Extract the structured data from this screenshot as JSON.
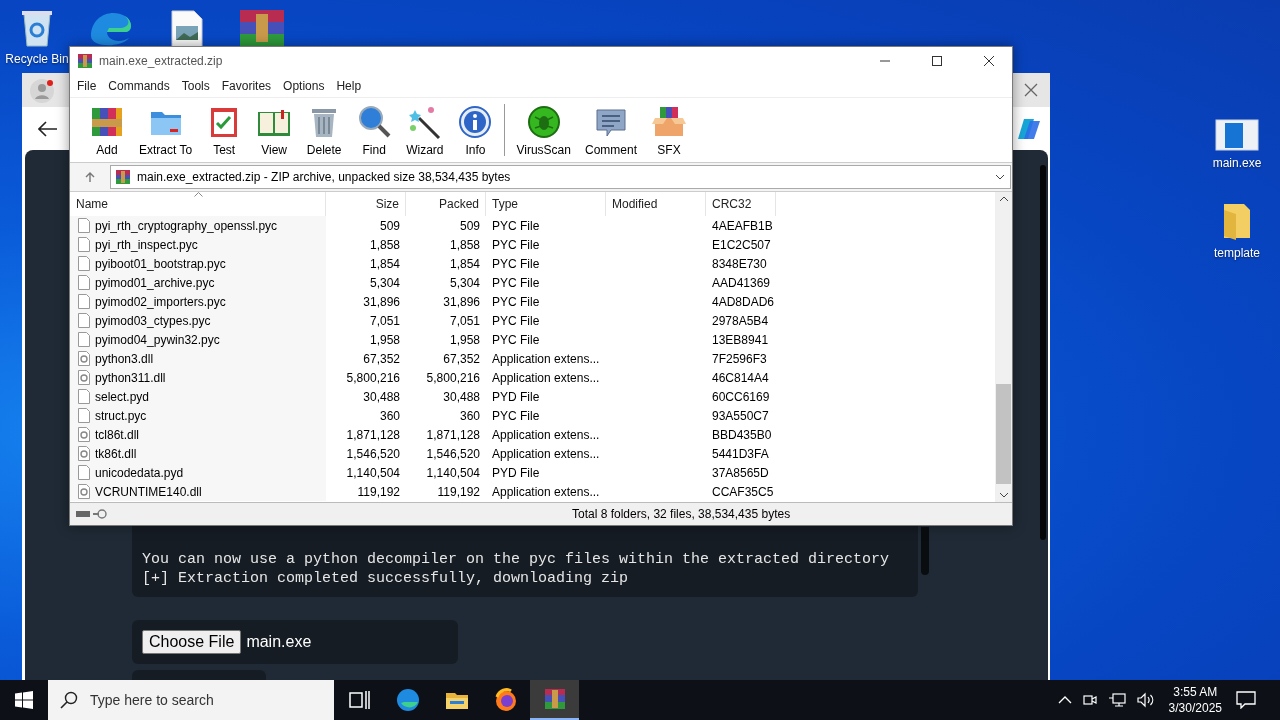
{
  "desktop": {
    "icons": [
      {
        "label": "Recycle Bin",
        "kind": "recycle"
      },
      {
        "label": "main.exe",
        "kind": "app"
      },
      {
        "label": "template",
        "kind": "folder"
      }
    ]
  },
  "browser": {
    "terminal_lines": [
      "You can now use a python decompiler on the pyc files within the extracted directory",
      "[+] Extraction completed successfully, downloading zip"
    ],
    "file_input": {
      "button": "Choose File",
      "value": "main.exe"
    }
  },
  "winrar": {
    "title": "main.exe_extracted.zip",
    "menu": [
      "File",
      "Commands",
      "Tools",
      "Favorites",
      "Options",
      "Help"
    ],
    "toolbar": [
      {
        "label": "Add",
        "kind": "add"
      },
      {
        "label": "Extract To",
        "kind": "extract"
      },
      {
        "label": "Test",
        "kind": "test"
      },
      {
        "label": "View",
        "kind": "view"
      },
      {
        "label": "Delete",
        "kind": "delete"
      },
      {
        "label": "Find",
        "kind": "find"
      },
      {
        "label": "Wizard",
        "kind": "wizard"
      },
      {
        "label": "Info",
        "kind": "info"
      },
      {
        "label": "VirusScan",
        "kind": "virusscan"
      },
      {
        "label": "Comment",
        "kind": "comment"
      },
      {
        "label": "SFX",
        "kind": "sfx"
      }
    ],
    "address": "main.exe_extracted.zip - ZIP archive, unpacked size 38,534,435 bytes",
    "columns": [
      {
        "label": "Name",
        "sorted": true
      },
      {
        "label": "Size",
        "sorted": false
      },
      {
        "label": "Packed",
        "sorted": false
      },
      {
        "label": "Type",
        "sorted": false
      },
      {
        "label": "Modified",
        "sorted": false
      },
      {
        "label": "CRC32",
        "sorted": false
      }
    ],
    "rows": [
      {
        "kind": "file",
        "name": "pyi_rth_cryptography_openssl.pyc",
        "size": "509",
        "packed": "509",
        "type": "PYC File",
        "crc32": "4AEAFB1B"
      },
      {
        "kind": "file",
        "name": "pyi_rth_inspect.pyc",
        "size": "1,858",
        "packed": "1,858",
        "type": "PYC File",
        "crc32": "E1C2C507"
      },
      {
        "kind": "file",
        "name": "pyiboot01_bootstrap.pyc",
        "size": "1,854",
        "packed": "1,854",
        "type": "PYC File",
        "crc32": "8348E730"
      },
      {
        "kind": "file",
        "name": "pyimod01_archive.pyc",
        "size": "5,304",
        "packed": "5,304",
        "type": "PYC File",
        "crc32": "AAD41369"
      },
      {
        "kind": "file",
        "name": "pyimod02_importers.pyc",
        "size": "31,896",
        "packed": "31,896",
        "type": "PYC File",
        "crc32": "4AD8DAD6"
      },
      {
        "kind": "file",
        "name": "pyimod03_ctypes.pyc",
        "size": "7,051",
        "packed": "7,051",
        "type": "PYC File",
        "crc32": "2978A5B4"
      },
      {
        "kind": "file",
        "name": "pyimod04_pywin32.pyc",
        "size": "1,958",
        "packed": "1,958",
        "type": "PYC File",
        "crc32": "13EB8941"
      },
      {
        "kind": "library",
        "name": "python3.dll",
        "size": "67,352",
        "packed": "67,352",
        "type": "Application extens...",
        "crc32": "7F2596F3"
      },
      {
        "kind": "library",
        "name": "python311.dll",
        "size": "5,800,216",
        "packed": "5,800,216",
        "type": "Application extens...",
        "crc32": "46C814A4"
      },
      {
        "kind": "file",
        "name": "select.pyd",
        "size": "30,488",
        "packed": "30,488",
        "type": "PYD File",
        "crc32": "60CC6169"
      },
      {
        "kind": "file",
        "name": "struct.pyc",
        "size": "360",
        "packed": "360",
        "type": "PYC File",
        "crc32": "93A550C7"
      },
      {
        "kind": "library",
        "name": "tcl86t.dll",
        "size": "1,871,128",
        "packed": "1,871,128",
        "type": "Application extens...",
        "crc32": "BBD435B0"
      },
      {
        "kind": "library",
        "name": "tk86t.dll",
        "size": "1,546,520",
        "packed": "1,546,520",
        "type": "Application extens...",
        "crc32": "5441D3FA"
      },
      {
        "kind": "file",
        "name": "unicodedata.pyd",
        "size": "1,140,504",
        "packed": "1,140,504",
        "type": "PYD File",
        "crc32": "37A8565D"
      },
      {
        "kind": "library",
        "name": "VCRUNTIME140.dll",
        "size": "119,192",
        "packed": "119,192",
        "type": "Application extens...",
        "crc32": "CCAF35C5"
      }
    ],
    "status": "Total 8 folders, 32 files, 38,534,435 bytes"
  },
  "taskbar": {
    "search_placeholder": "Type here to search",
    "apps": [
      {
        "kind": "taskview",
        "selected": false
      },
      {
        "kind": "edge",
        "selected": false
      },
      {
        "kind": "explorer",
        "selected": false
      },
      {
        "kind": "firefox",
        "selected": false
      },
      {
        "kind": "winrar",
        "selected": true
      }
    ],
    "time": "3:55 AM",
    "date": "3/30/2025"
  }
}
